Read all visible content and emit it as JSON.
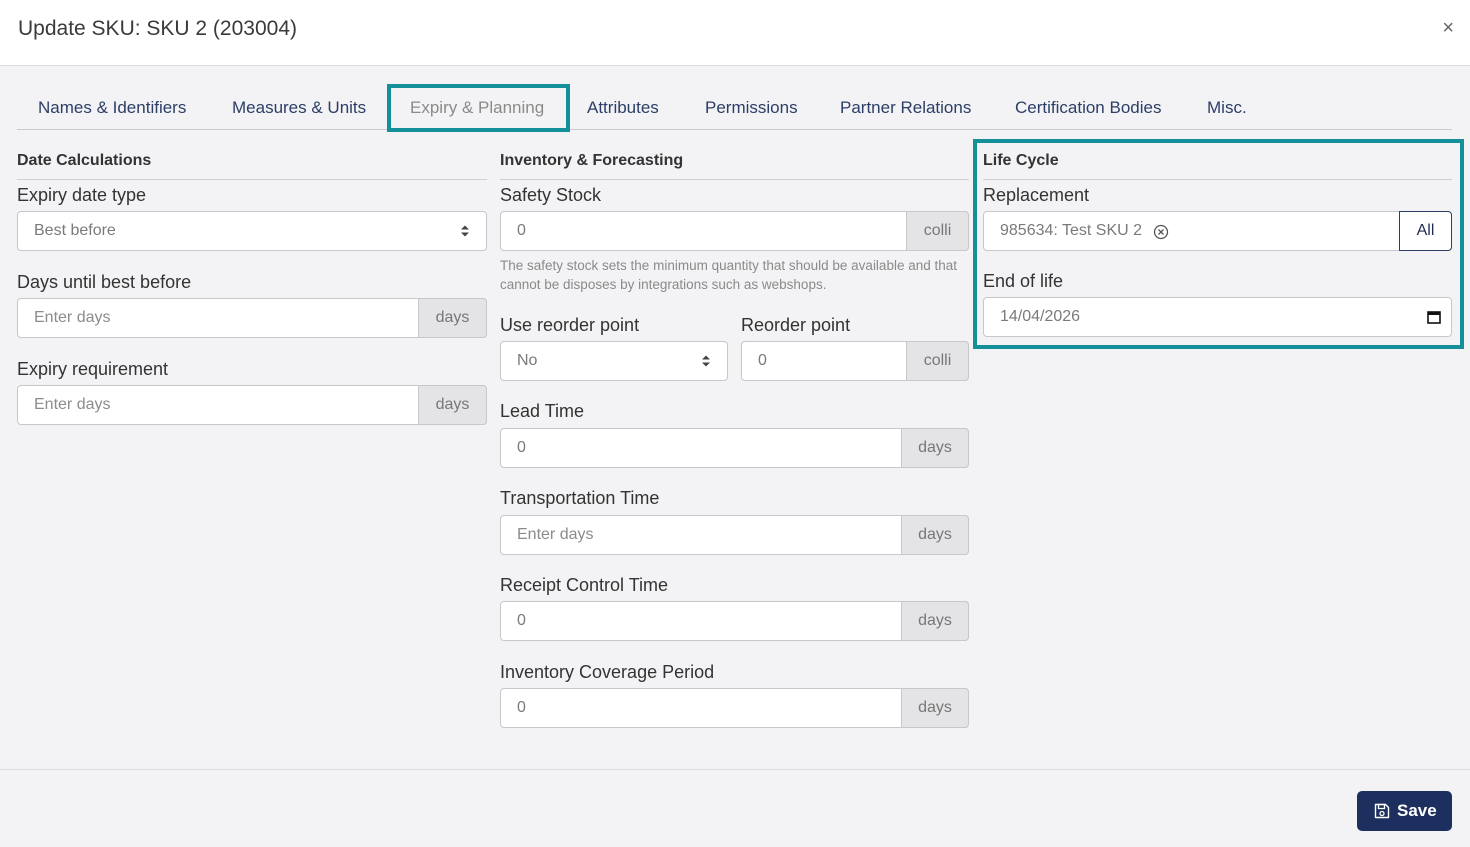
{
  "modal": {
    "title": "Update SKU: SKU 2 (203004)",
    "close_label": "×"
  },
  "tabs": [
    {
      "label": "Names & Identifiers"
    },
    {
      "label": "Measures & Units"
    },
    {
      "label": "Expiry & Planning",
      "active": true
    },
    {
      "label": "Attributes"
    },
    {
      "label": "Permissions"
    },
    {
      "label": "Partner Relations"
    },
    {
      "label": "Certification Bodies"
    },
    {
      "label": "Misc."
    }
  ],
  "date_calculations": {
    "title": "Date Calculations",
    "expiry_date_type": {
      "label": "Expiry date type",
      "value": "Best before"
    },
    "days_until_best_before": {
      "label": "Days until best before",
      "placeholder": "Enter days",
      "unit": "days"
    },
    "expiry_requirement": {
      "label": "Expiry requirement",
      "placeholder": "Enter days",
      "unit": "days"
    }
  },
  "inventory": {
    "title": "Inventory & Forecasting",
    "safety_stock": {
      "label": "Safety Stock",
      "value": "0",
      "unit": "colli",
      "help": "The safety stock sets the minimum quantity that should be available and that cannot be disposes by integrations such as webshops."
    },
    "use_reorder_point": {
      "label": "Use reorder point",
      "value": "No"
    },
    "reorder_point": {
      "label": "Reorder point",
      "value": "0",
      "unit": "colli"
    },
    "lead_time": {
      "label": "Lead Time",
      "value": "0",
      "unit": "days"
    },
    "transportation_time": {
      "label": "Transportation Time",
      "placeholder": "Enter days",
      "unit": "days"
    },
    "receipt_control_time": {
      "label": "Receipt Control Time",
      "value": "0",
      "unit": "days"
    },
    "inventory_coverage_period": {
      "label": "Inventory Coverage Period",
      "value": "0",
      "unit": "days"
    }
  },
  "life_cycle": {
    "title": "Life Cycle",
    "replacement": {
      "label": "Replacement",
      "value": "985634: Test SKU 2",
      "button": "All"
    },
    "end_of_life": {
      "label": "End of life",
      "value": "14/04/2026"
    }
  },
  "footer": {
    "save_label": "Save"
  },
  "colors": {
    "highlight": "#13909a",
    "primary": "#1c2f5e",
    "tab_text": "#2c3e66"
  }
}
